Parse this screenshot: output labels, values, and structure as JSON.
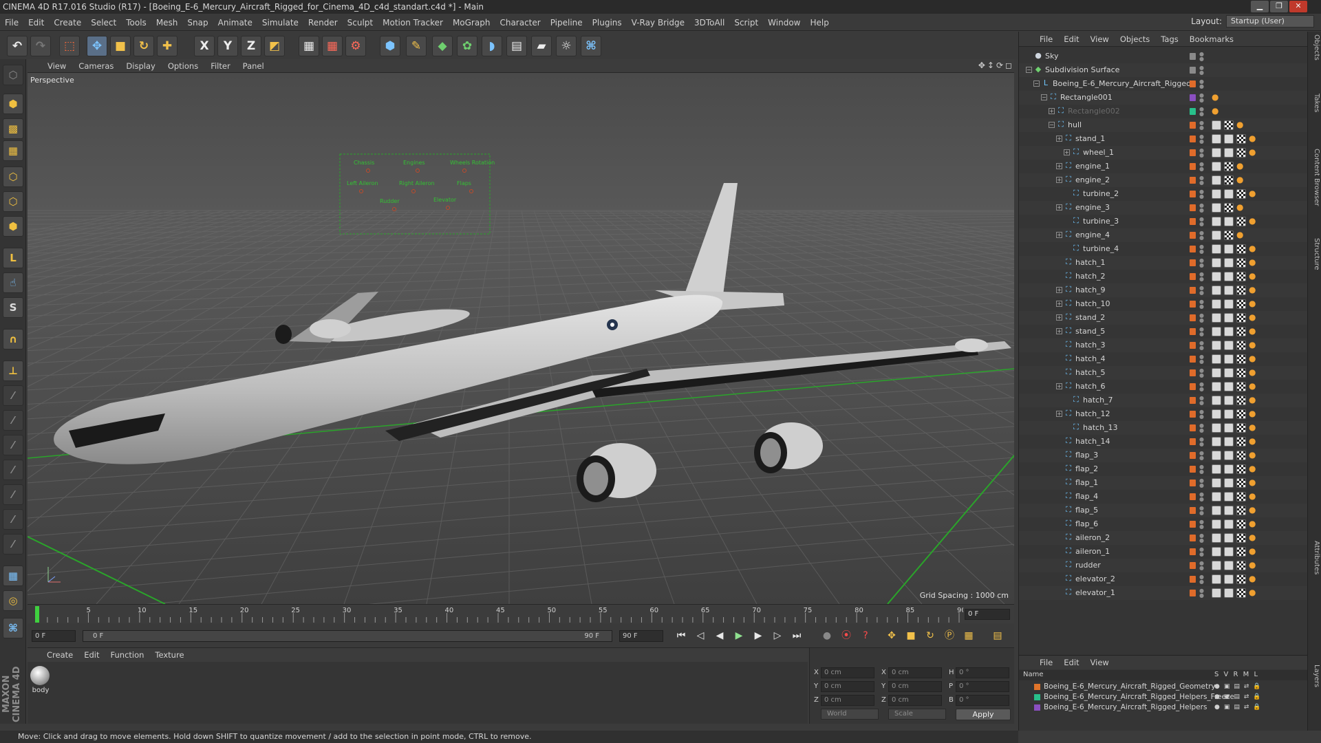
{
  "window": {
    "title": "CINEMA 4D R17.016 Studio (R17) - [Boeing_E-6_Mercury_Aircraft_Rigged_for_Cinema_4D_c4d_standart.c4d *] - Main",
    "btn_min": "▁",
    "btn_max": "❐",
    "btn_close": "✕"
  },
  "menu": [
    "File",
    "Edit",
    "Create",
    "Select",
    "Tools",
    "Mesh",
    "Snap",
    "Animate",
    "Simulate",
    "Render",
    "Sculpt",
    "Motion Tracker",
    "MoGraph",
    "Character",
    "Pipeline",
    "Plugins",
    "V-Ray Bridge",
    "3DToAll",
    "Script",
    "Window",
    "Help"
  ],
  "layout": {
    "label": "Layout:",
    "value": "Startup (User)"
  },
  "viewport": {
    "menu": [
      "View",
      "Cameras",
      "Display",
      "Options",
      "Filter",
      "Panel"
    ],
    "label": "Perspective",
    "grid_spacing": "Grid Spacing : 1000 cm",
    "hud_labels": [
      "Chassis",
      "Engines",
      "Wheels Rotation",
      "Left Aileron",
      "Right Aileron",
      "Flaps",
      "Rudder",
      "Elevator"
    ]
  },
  "timeline": {
    "ticks": [
      "0",
      "5",
      "10",
      "15",
      "20",
      "25",
      "30",
      "35",
      "40",
      "45",
      "50",
      "55",
      "60",
      "65",
      "70",
      "75",
      "80",
      "85",
      "90"
    ],
    "frame_display": "0 F"
  },
  "transport": {
    "start": "0 F",
    "range_start": "0 F",
    "range_end": "90 F",
    "end": "90 F"
  },
  "material": {
    "menu": [
      "Create",
      "Edit",
      "Function",
      "Texture"
    ],
    "items": [
      {
        "name": "body"
      }
    ]
  },
  "coords": {
    "rows": [
      {
        "a": "X",
        "av": "0 cm",
        "b": "X",
        "bv": "0 cm",
        "c": "H",
        "cv": "0 °"
      },
      {
        "a": "Y",
        "av": "0 cm",
        "b": "Y",
        "bv": "0 cm",
        "c": "P",
        "cv": "0 °"
      },
      {
        "a": "Z",
        "av": "0 cm",
        "b": "Z",
        "bv": "0 cm",
        "c": "B",
        "cv": "0 °"
      }
    ],
    "mode1": "World",
    "mode2": "Scale",
    "apply": "Apply"
  },
  "status": "Move: Click and drag to move elements. Hold down SHIFT to quantize movement / add to the selection in point mode, CTRL to remove.",
  "objects": {
    "menu": [
      "File",
      "Edit",
      "View",
      "Objects",
      "Tags",
      "Bookmarks"
    ],
    "items": [
      {
        "name": "Sky",
        "depth": 0,
        "expand": false,
        "tags": 0
      },
      {
        "name": "Subdivision Surface",
        "depth": 0,
        "expand": true,
        "tags": 0
      },
      {
        "name": "Boeing_E-6_Mercury_Aircraft_Rigged",
        "depth": 1,
        "expand": true,
        "tags": 0
      },
      {
        "name": "Rectangle001",
        "depth": 2,
        "expand": true,
        "tags": 1
      },
      {
        "name": "Rectangle002",
        "depth": 3,
        "expand": true,
        "tags": 1
      },
      {
        "name": "hull",
        "depth": 3,
        "expand": true,
        "tags": 3
      },
      {
        "name": "stand_1",
        "depth": 4,
        "expand": true,
        "tags": 4
      },
      {
        "name": "wheel_1",
        "depth": 5,
        "expand": true,
        "tags": 4
      },
      {
        "name": "engine_1",
        "depth": 4,
        "expand": true,
        "tags": 3
      },
      {
        "name": "engine_2",
        "depth": 4,
        "expand": true,
        "tags": 3
      },
      {
        "name": "turbine_2",
        "depth": 5,
        "expand": false,
        "tags": 4
      },
      {
        "name": "engine_3",
        "depth": 4,
        "expand": true,
        "tags": 3
      },
      {
        "name": "turbine_3",
        "depth": 5,
        "expand": false,
        "tags": 4
      },
      {
        "name": "engine_4",
        "depth": 4,
        "expand": true,
        "tags": 3
      },
      {
        "name": "turbine_4",
        "depth": 5,
        "expand": false,
        "tags": 4
      },
      {
        "name": "hatch_1",
        "depth": 4,
        "expand": false,
        "tags": 4
      },
      {
        "name": "hatch_2",
        "depth": 4,
        "expand": false,
        "tags": 4
      },
      {
        "name": "hatch_9",
        "depth": 4,
        "expand": true,
        "tags": 4
      },
      {
        "name": "hatch_10",
        "depth": 4,
        "expand": true,
        "tags": 4
      },
      {
        "name": "stand_2",
        "depth": 4,
        "expand": true,
        "tags": 4
      },
      {
        "name": "stand_5",
        "depth": 4,
        "expand": true,
        "tags": 4
      },
      {
        "name": "hatch_3",
        "depth": 4,
        "expand": false,
        "tags": 4
      },
      {
        "name": "hatch_4",
        "depth": 4,
        "expand": false,
        "tags": 4
      },
      {
        "name": "hatch_5",
        "depth": 4,
        "expand": false,
        "tags": 4
      },
      {
        "name": "hatch_6",
        "depth": 4,
        "expand": true,
        "tags": 4
      },
      {
        "name": "hatch_7",
        "depth": 5,
        "expand": false,
        "tags": 4
      },
      {
        "name": "hatch_12",
        "depth": 4,
        "expand": true,
        "tags": 4
      },
      {
        "name": "hatch_13",
        "depth": 5,
        "expand": false,
        "tags": 4
      },
      {
        "name": "hatch_14",
        "depth": 4,
        "expand": false,
        "tags": 4
      },
      {
        "name": "flap_3",
        "depth": 4,
        "expand": false,
        "tags": 4
      },
      {
        "name": "flap_2",
        "depth": 4,
        "expand": false,
        "tags": 4
      },
      {
        "name": "flap_1",
        "depth": 4,
        "expand": false,
        "tags": 4
      },
      {
        "name": "flap_4",
        "depth": 4,
        "expand": false,
        "tags": 4
      },
      {
        "name": "flap_5",
        "depth": 4,
        "expand": false,
        "tags": 4
      },
      {
        "name": "flap_6",
        "depth": 4,
        "expand": false,
        "tags": 4
      },
      {
        "name": "aileron_2",
        "depth": 4,
        "expand": false,
        "tags": 4
      },
      {
        "name": "aileron_1",
        "depth": 4,
        "expand": false,
        "tags": 4
      },
      {
        "name": "rudder",
        "depth": 4,
        "expand": false,
        "tags": 4
      },
      {
        "name": "elevator_2",
        "depth": 4,
        "expand": false,
        "tags": 4
      },
      {
        "name": "elevator_1",
        "depth": 4,
        "expand": false,
        "tags": 4
      }
    ]
  },
  "layers": {
    "menu": [
      "File",
      "Edit",
      "View"
    ],
    "header": {
      "name": "Name",
      "flags": "S V R M L"
    },
    "items": [
      {
        "name": "Boeing_E-6_Mercury_Aircraft_Rigged_Geometry",
        "color": "#e0742a"
      },
      {
        "name": "Boeing_E-6_Mercury_Aircraft_Rigged_Helpers_Freeze",
        "color": "#28c08a"
      },
      {
        "name": "Boeing_E-6_Mercury_Aircraft_Rigged_Helpers",
        "color": "#8a4fc0"
      }
    ]
  },
  "right_tabs": [
    "Objects",
    "Takes",
    "Content Browser",
    "Structure",
    "Attributes",
    "Layers"
  ],
  "maxon": "MAXON CINEMA 4D"
}
